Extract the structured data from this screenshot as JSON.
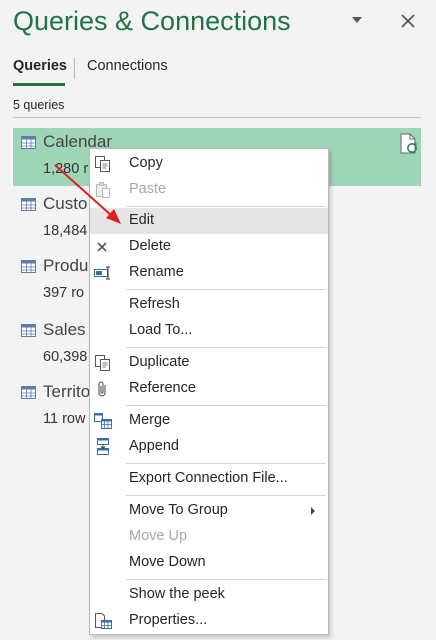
{
  "pane": {
    "title": "Queries & Connections"
  },
  "tabs": {
    "queries": "Queries",
    "connections": "Connections"
  },
  "query_count": "5 queries",
  "queries": [
    {
      "name": "Calendar",
      "rows": "1,280 r"
    },
    {
      "name": "Custo",
      "rows": "18,484"
    },
    {
      "name": "Produ",
      "rows": "397 ro"
    },
    {
      "name": "Sales",
      "rows": "60,398"
    },
    {
      "name": "Territo",
      "rows": "11 row"
    }
  ],
  "menu": {
    "copy": "Copy",
    "paste": "Paste",
    "edit": "Edit",
    "delete": "Delete",
    "rename": "Rename",
    "refresh": "Refresh",
    "load_to": "Load To...",
    "duplicate": "Duplicate",
    "reference": "Reference",
    "merge": "Merge",
    "append": "Append",
    "export": "Export Connection File...",
    "move_to_group": "Move To Group",
    "move_up": "Move Up",
    "move_down": "Move Down",
    "show_peek": "Show the peek",
    "properties": "Properties..."
  },
  "colors": {
    "accent": "#217346",
    "selected_row": "#9fd5b7",
    "arrow": "#e02020"
  }
}
